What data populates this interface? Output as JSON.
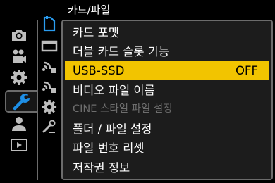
{
  "menu": {
    "title": "카드/파일",
    "items": [
      {
        "label": "카드 포맷",
        "value": ""
      },
      {
        "label": "더블 카드 슬롯 기능",
        "value": ""
      },
      {
        "label": "USB-SSD",
        "value": "OFF"
      },
      {
        "label": "비디오 파일 이름",
        "value": ""
      },
      {
        "label": "CINE 스타일 파일 설정",
        "value": ""
      },
      {
        "label": "폴더 / 파일 설정",
        "value": ""
      },
      {
        "label": "파일 번호 리셋",
        "value": ""
      },
      {
        "label": "저작권 정보",
        "value": ""
      }
    ],
    "selected_index": 2,
    "disabled_index": 4
  },
  "left_tabs": [
    {
      "icon": "camera-icon"
    },
    {
      "icon": "video-camera-icon"
    },
    {
      "icon": "gear-icon"
    },
    {
      "icon": "wrench-icon",
      "active": true
    },
    {
      "icon": "person-icon"
    },
    {
      "icon": "playback-icon"
    }
  ],
  "sub_tabs": [
    {
      "icon": "card-icon",
      "active": true
    },
    {
      "icon": "folder-icon"
    },
    {
      "icon": "signal-icon"
    },
    {
      "icon": "signal-icon"
    },
    {
      "icon": "gear-icon"
    },
    {
      "icon": "edit-icon"
    }
  ],
  "colors": {
    "background": "#000000",
    "panel": "#1c1c1c",
    "border": "#6c6c6c",
    "highlight": "#f2c400",
    "disabled_text": "#6e6e6e"
  }
}
